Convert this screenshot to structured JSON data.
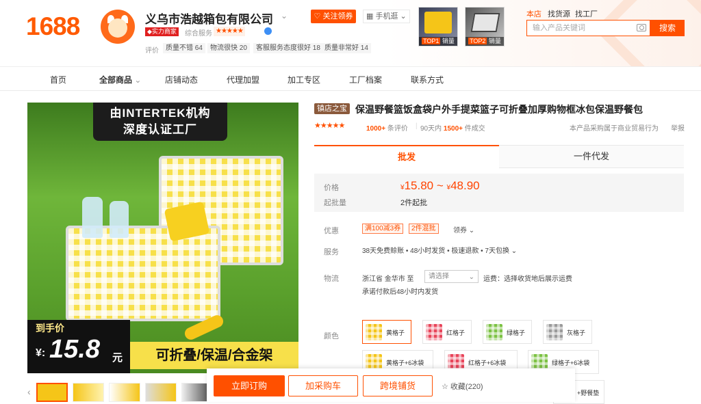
{
  "header": {
    "logo": "1688",
    "company_name": "义乌市浩越箱包有限公司",
    "follow_label": "关注领券",
    "mobile_label": "手机逛",
    "badge_power": "实力商家",
    "service_label": "综合服务",
    "service_stars": "★★★★★",
    "rating_label": "评价",
    "rating_tags": [
      "质量不错 64",
      "物流很快 20",
      "客服服务态度很好 18",
      "质量非常好 14"
    ],
    "top_products": [
      {
        "rank": "TOP1",
        "text": "销量"
      },
      {
        "rank": "TOP2",
        "text": "销量"
      }
    ],
    "top_nav": [
      "本店",
      "找货源",
      "找工厂"
    ],
    "search_placeholder": "输入产品关键词",
    "search_button": "搜索"
  },
  "nav": {
    "items": [
      "首页",
      "全部商品",
      "店铺动态",
      "代理加盟",
      "加工专区",
      "工厂档案",
      "联系方式"
    ],
    "active": "全部商品"
  },
  "gallery": {
    "banner_line1": "由INTERTEK机构",
    "banner_line2": "深度认证工厂",
    "price_label": "到手价",
    "price_currency": "¥:",
    "price_value": "15.8",
    "price_unit": "元",
    "feature_text": "可折叠/保温/合金架",
    "thumb_prev": "‹"
  },
  "product": {
    "store_badge": "镇店之宝",
    "title": "保温野餐篮饭盒袋户外手提菜篮子可折叠加厚购物框冰包保温野餐包",
    "stars": "★★★★★",
    "review_count": "1000+",
    "review_label": "条评价",
    "sales_prefix": "90天内",
    "sales_count": "1500+",
    "sales_suffix": "件成交",
    "trade_note": "本产品采购属于商业贸易行为",
    "report": "举报"
  },
  "tabs": {
    "wholesale": "批发",
    "dropship": "一件代发"
  },
  "pricing": {
    "price_label": "价格",
    "currency": "¥",
    "price_min": "15.80",
    "tilde": "~",
    "price_max": "48.90",
    "moq_label": "起批量",
    "moq_value": "2件起批"
  },
  "promo": {
    "label": "优惠",
    "coupons": [
      "满100减3券",
      "2件混批"
    ],
    "get_coupon": "领券 ⌄"
  },
  "service": {
    "label": "服务",
    "text": "38天免费赊账 • 48小时发货 • 极速退款 • 7天包换 ⌄"
  },
  "logistics": {
    "label": "物流",
    "origin": "浙江省 金华市   至",
    "dest_placeholder": "请选择",
    "freight": "运费：选择收货地后展示运费",
    "ship_note": "承诺付款后48小时内发货"
  },
  "colors": {
    "label": "颜色",
    "options": [
      "黄格子",
      "红格子",
      "绿格子",
      "灰格子",
      "黄格子+6冰袋",
      "红格子+6冰袋",
      "绿格子+6冰袋",
      "+野餐垫"
    ],
    "selected": "黄格子",
    "swatch_colors": [
      "#f5c518",
      "#e8455a",
      "#7cc243",
      "#9a9a9a",
      "#f5c518",
      "#e8455a",
      "#7cc243",
      "#bbbbbb"
    ]
  },
  "actions": {
    "buy": "立即订购",
    "cart": "加采购车",
    "cross": "跨境铺货",
    "favorite": "☆ 收藏(220)"
  },
  "theme": {
    "accent": "#ff5000"
  }
}
